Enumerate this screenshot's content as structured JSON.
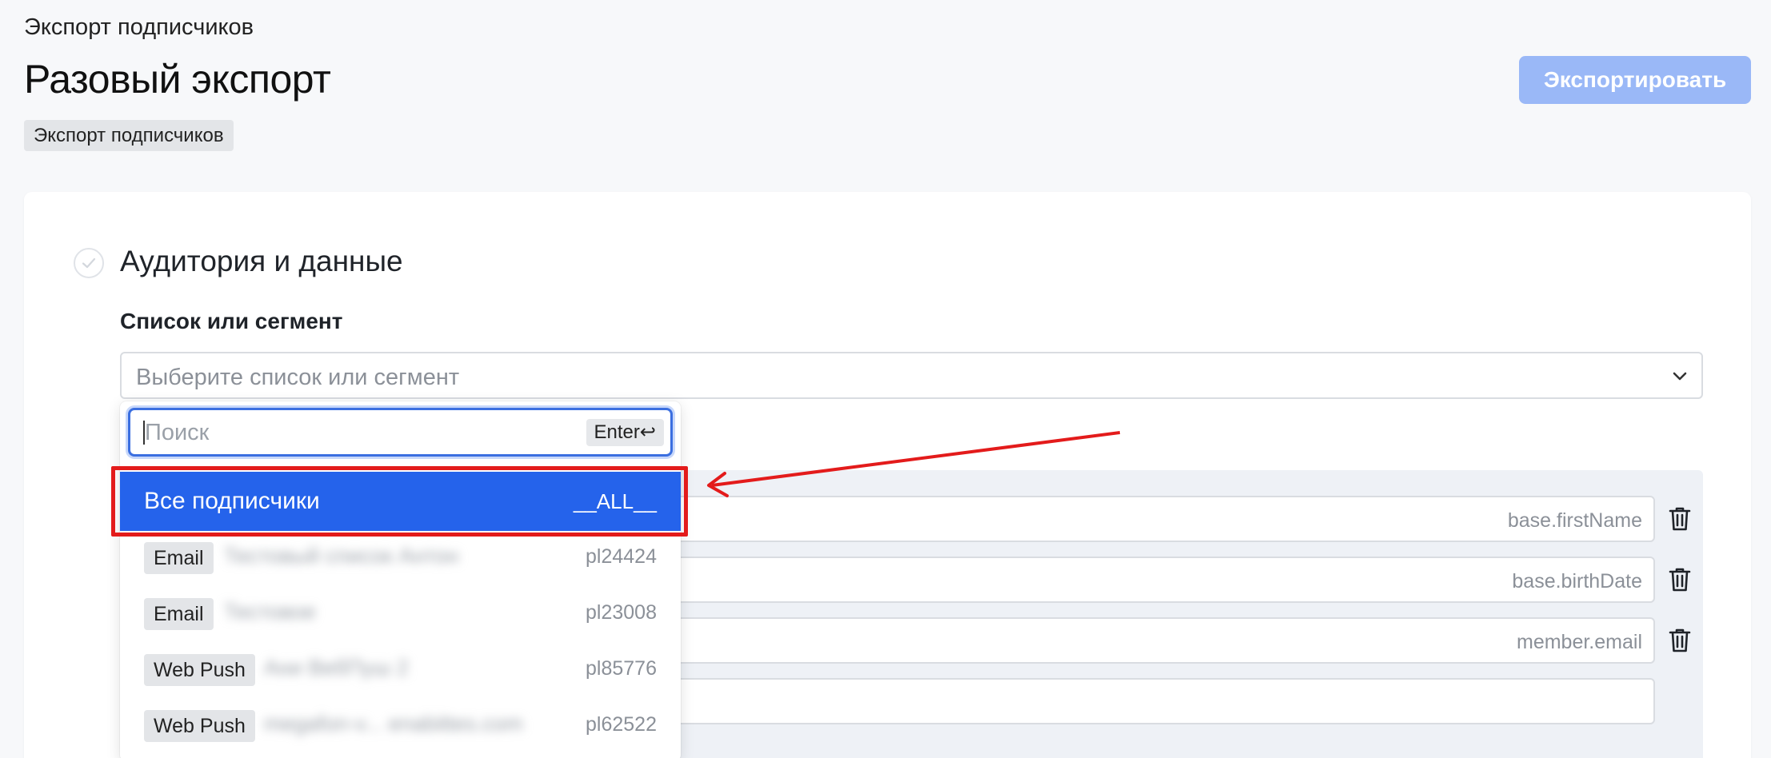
{
  "header": {
    "breadcrumb": "Экспорт подписчиков",
    "title": "Разовый экспорт",
    "tag": "Экспорт подписчиков",
    "export_button": "Экспортировать"
  },
  "section": {
    "title": "Аудитория и данные",
    "field_label": "Список или сегмент",
    "select_placeholder": "Выберите список или сегмент"
  },
  "dropdown": {
    "search_placeholder": "Поиск",
    "enter_hint": "Enter↩",
    "selected_option": {
      "label": "Все подписчики",
      "code": "__ALL__"
    },
    "options": [
      {
        "badge": "Email",
        "name": "Тестовый список Антон",
        "code": "pl24424"
      },
      {
        "badge": "Email",
        "name": "Тестовое",
        "code": "pl23008"
      },
      {
        "badge": "Web Push",
        "name": "Ани ВебПуш 2",
        "code": "pl85776"
      },
      {
        "badge": "Web Push",
        "name": "megafon-v... enabittes.com",
        "code": "pl62522"
      }
    ]
  },
  "mapping": {
    "fields": [
      "base.firstName",
      "base.birthDate",
      "member.email",
      ""
    ]
  },
  "colors": {
    "accent": "#2563eb",
    "export_button_disabled": "#9ab8f7",
    "annotation_red": "#e31b1b"
  }
}
